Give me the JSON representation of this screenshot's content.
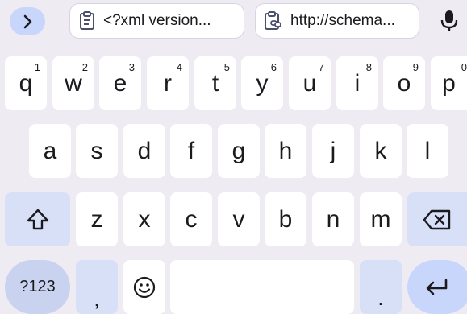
{
  "suggestion_strip": {
    "chips": [
      {
        "label": "<?xml version...",
        "icon": "clipboard-icon"
      },
      {
        "label": "http://schema...",
        "icon": "clipboard-link-icon"
      }
    ],
    "expand_icon": "chevron-right-icon",
    "mic_icon": "microphone-icon"
  },
  "keyboard": {
    "row1": [
      {
        "label": "q",
        "hint": "1"
      },
      {
        "label": "w",
        "hint": "2"
      },
      {
        "label": "e",
        "hint": "3"
      },
      {
        "label": "r",
        "hint": "4"
      },
      {
        "label": "t",
        "hint": "5"
      },
      {
        "label": "y",
        "hint": "6"
      },
      {
        "label": "u",
        "hint": "7"
      },
      {
        "label": "i",
        "hint": "8"
      },
      {
        "label": "o",
        "hint": "9"
      },
      {
        "label": "p",
        "hint": "0"
      }
    ],
    "row2": [
      "a",
      "s",
      "d",
      "f",
      "g",
      "h",
      "j",
      "k",
      "l"
    ],
    "row3": [
      "z",
      "x",
      "c",
      "v",
      "b",
      "n",
      "m"
    ],
    "symbols_label": "?123",
    "comma_label": ",",
    "period_label": ".",
    "shift_icon": "shift-icon",
    "backspace_icon": "backspace-icon",
    "emoji_icon": "emoji-icon",
    "enter_icon": "enter-arrow-icon"
  },
  "colors": {
    "background": "#efebf3",
    "key": "#ffffff",
    "function_key": "#d8e0f8",
    "accent": "#c9d6fb"
  }
}
